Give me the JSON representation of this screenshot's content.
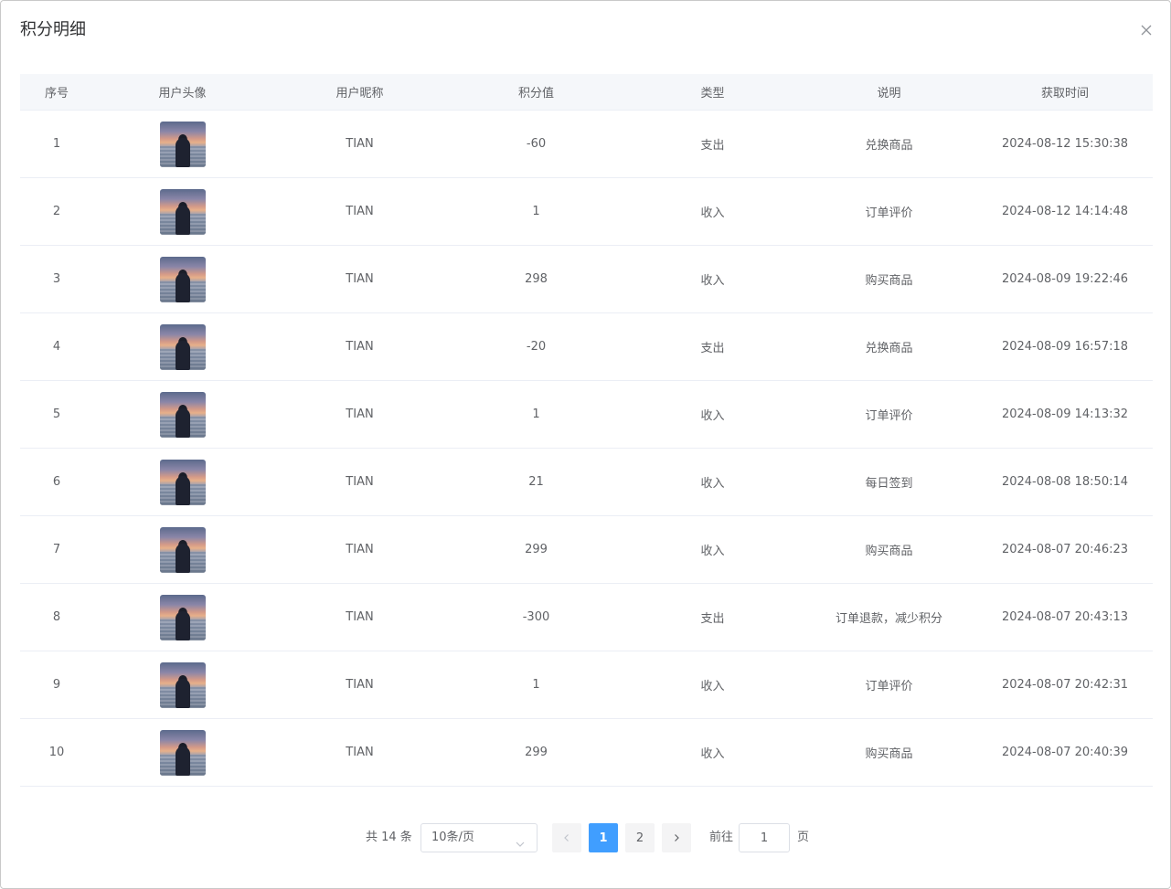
{
  "dialog": {
    "title": "积分明细"
  },
  "table": {
    "headers": {
      "index": "序号",
      "avatar": "用户头像",
      "nickname": "用户昵称",
      "points": "积分值",
      "type": "类型",
      "description": "说明",
      "time": "获取时间"
    },
    "rows": [
      {
        "index": "1",
        "nickname": "TIAN",
        "points": "-60",
        "type": "支出",
        "description": "兑换商品",
        "time": "2024-08-12 15:30:38"
      },
      {
        "index": "2",
        "nickname": "TIAN",
        "points": "1",
        "type": "收入",
        "description": "订单评价",
        "time": "2024-08-12 14:14:48"
      },
      {
        "index": "3",
        "nickname": "TIAN",
        "points": "298",
        "type": "收入",
        "description": "购买商品",
        "time": "2024-08-09 19:22:46"
      },
      {
        "index": "4",
        "nickname": "TIAN",
        "points": "-20",
        "type": "支出",
        "description": "兑换商品",
        "time": "2024-08-09 16:57:18"
      },
      {
        "index": "5",
        "nickname": "TIAN",
        "points": "1",
        "type": "收入",
        "description": "订单评价",
        "time": "2024-08-09 14:13:32"
      },
      {
        "index": "6",
        "nickname": "TIAN",
        "points": "21",
        "type": "收入",
        "description": "每日签到",
        "time": "2024-08-08 18:50:14"
      },
      {
        "index": "7",
        "nickname": "TIAN",
        "points": "299",
        "type": "收入",
        "description": "购买商品",
        "time": "2024-08-07 20:46:23"
      },
      {
        "index": "8",
        "nickname": "TIAN",
        "points": "-300",
        "type": "支出",
        "description": "订单退款，减少积分",
        "time": "2024-08-07 20:43:13"
      },
      {
        "index": "9",
        "nickname": "TIAN",
        "points": "1",
        "type": "收入",
        "description": "订单评价",
        "time": "2024-08-07 20:42:31"
      },
      {
        "index": "10",
        "nickname": "TIAN",
        "points": "299",
        "type": "收入",
        "description": "购买商品",
        "time": "2024-08-07 20:40:39"
      }
    ]
  },
  "pagination": {
    "total": "共 14 条",
    "page_size": "10条/页",
    "pages": [
      "1",
      "2"
    ],
    "current_page": "1",
    "goto_label": "前往",
    "goto_value": "1",
    "goto_suffix": "页"
  },
  "colors": {
    "accent": "#409eff",
    "header_bg": "#f5f7fa"
  }
}
